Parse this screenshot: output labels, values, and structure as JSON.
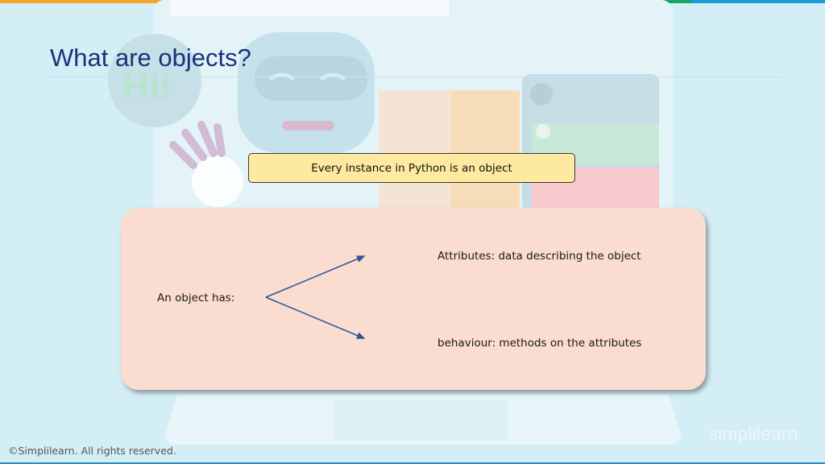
{
  "slide": {
    "title": "What are objects?",
    "callout": "Every instance in Python is an object",
    "object_has_label": "An object has:",
    "attributes_text": "Attributes: data describing the object",
    "behaviour_text": "behaviour: methods on the attributes",
    "footer": "©Simplilearn. All rights reserved.",
    "logo_text": "simplilearn",
    "bg_bubble_text": "HI!"
  },
  "colors": {
    "title": "#16337a",
    "callout_fill": "#fde9a0",
    "panel_fill": "#fbdcd0",
    "arrow": "#2f5597",
    "top_stripe": [
      "#f4a629",
      "#e35a2b",
      "#17a660",
      "#1a9bd7"
    ]
  }
}
